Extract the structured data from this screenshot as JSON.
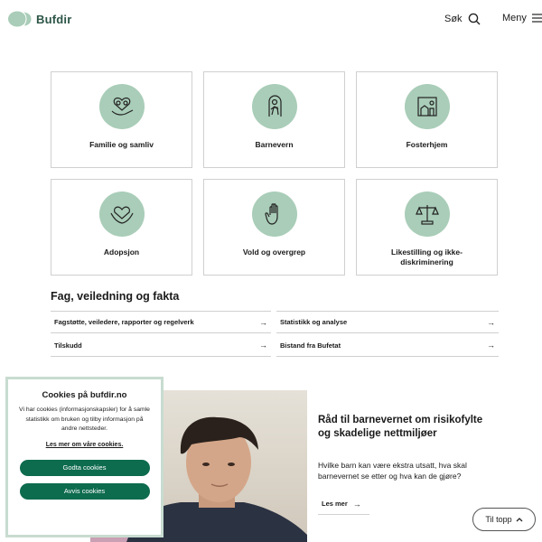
{
  "header": {
    "logo_text": "Bufdir",
    "search_label": "Søk",
    "menu_label": "Meny"
  },
  "categories": [
    {
      "label": "Familie og samliv",
      "icon": "family-icon"
    },
    {
      "label": "Barnevern",
      "icon": "child-welfare-icon"
    },
    {
      "label": "Fosterhjem",
      "icon": "foster-home-icon"
    },
    {
      "label": "Adopsjon",
      "icon": "heart-hands-icon"
    },
    {
      "label": "Vold og overgrep",
      "icon": "stop-hand-icon"
    },
    {
      "label": "Likestilling og ikke-diskriminering",
      "icon": "scales-icon"
    }
  ],
  "resources": {
    "title": "Fag, veiledning og fakta",
    "links": [
      "Fagstøtte, veiledere, rapporter og regelverk",
      "Statistikk og analyse",
      "Tilskudd",
      "Bistand fra Bufetat"
    ]
  },
  "feature": {
    "title": "Råd til barnevernet om risikofylte og skadelige nettmiljøer",
    "text": "Hvilke barn kan være ekstra utsatt, hva skal barnevernet se etter og hva kan de gjøre?",
    "link_label": "Les mer"
  },
  "to_top_label": "Til topp",
  "cookie": {
    "title": "Cookies på bufdir.no",
    "text": "Vi har cookies (informasjonskapsler) for å samle statistikk om bruken og tilby informasjon på andre nettsteder.",
    "more_link": "Les mer om våre cookies.",
    "accept_label": "Godta cookies",
    "reject_label": "Avvis cookies"
  },
  "colors": {
    "accent": "#0d6b4e",
    "icon_bg": "#a9cdb8",
    "brand": "#2b5545"
  }
}
